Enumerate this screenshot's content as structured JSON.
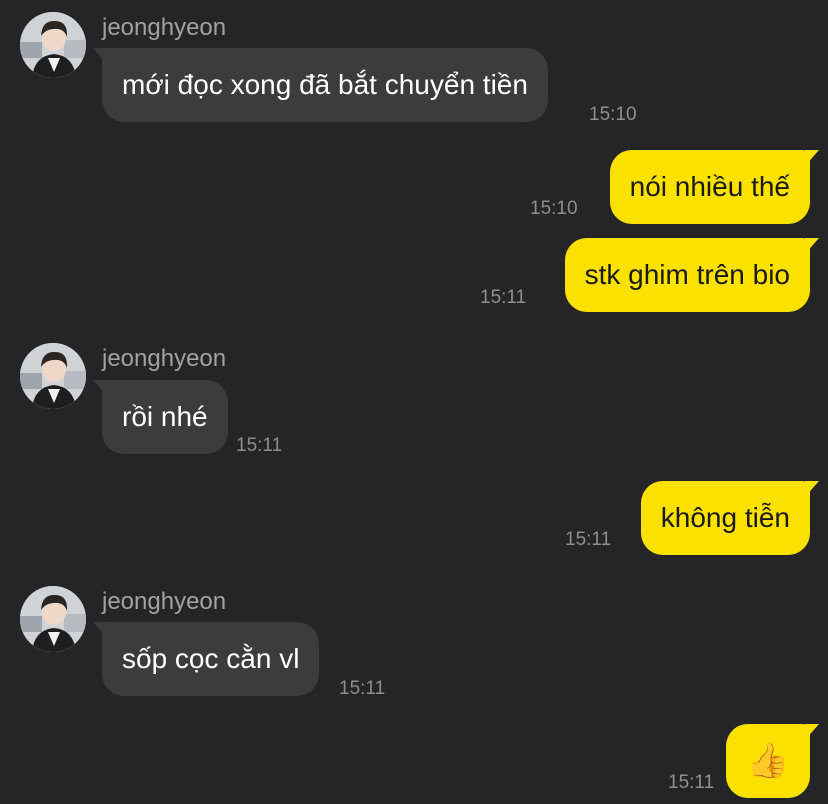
{
  "contact": {
    "name": "jeonghyeon"
  },
  "messages": [
    {
      "direction": "in",
      "sender": "jeonghyeon",
      "text": "mới đọc xong đã bắt chuyển tiền",
      "time": "15:10"
    },
    {
      "direction": "out",
      "text": "nói nhiều thế",
      "time": "15:10"
    },
    {
      "direction": "out",
      "text": "stk ghim trên bio",
      "time": "15:11"
    },
    {
      "direction": "in",
      "sender": "jeonghyeon",
      "text": "rồi nhé",
      "time": "15:11"
    },
    {
      "direction": "out",
      "text": "không tiễn",
      "time": "15:11"
    },
    {
      "direction": "in",
      "sender": "jeonghyeon",
      "text": "sốp cọc cằn vl",
      "time": "15:11"
    },
    {
      "direction": "out",
      "text": "👍",
      "time": "15:11"
    }
  ],
  "colors": {
    "background": "#252527",
    "incoming_bubble": "#3c3c3f",
    "outgoing_bubble": "#fae100",
    "sender_name": "#a2a2a6",
    "timestamp": "#8e8e93"
  }
}
